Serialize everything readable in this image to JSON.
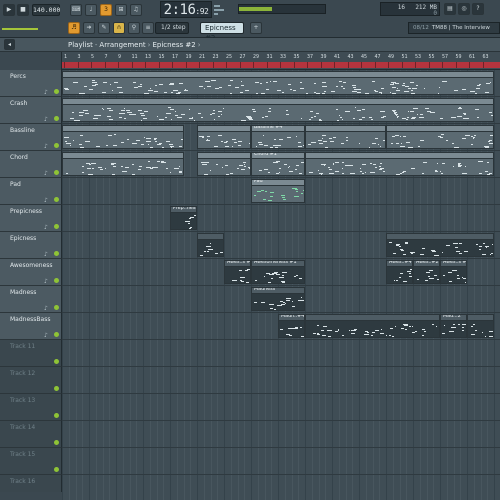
{
  "toolbar": {
    "tempo": "140.000",
    "time_main": "2:16",
    "time_sub": ":92",
    "snap": "1/2 step",
    "pattern": "Epicness #2",
    "cpu_value": "16",
    "mem_value": "212 MB",
    "mem_sub": "0",
    "news_date": "08/12",
    "news_text": "TM88 | The Interview",
    "buttons": [
      "play",
      "stop",
      "record",
      "pat-song",
      "song",
      "mic",
      "draw",
      "paint",
      "snap-magnet",
      "slice",
      "select",
      "zoom",
      "mute",
      "playback"
    ],
    "accent_color": "#e29a2f",
    "meter_color": "#8cb43a"
  },
  "breadcrumb": {
    "root": "Playlist",
    "section": "Arrangement",
    "pattern": "Epicness #2"
  },
  "ruler": {
    "ticks": [
      "1",
      "3",
      "5",
      "7",
      "9",
      "11",
      "13",
      "15",
      "17",
      "19",
      "21",
      "23",
      "25",
      "27",
      "29",
      "31",
      "33",
      "35",
      "37",
      "39",
      "41",
      "43",
      "45",
      "47",
      "49",
      "51",
      "53",
      "55",
      "57",
      "59",
      "61",
      "63"
    ]
  },
  "tracks": [
    {
      "name": "Percs",
      "empty": false
    },
    {
      "name": "Crash",
      "empty": false
    },
    {
      "name": "Bassline",
      "empty": false
    },
    {
      "name": "Chord",
      "empty": false
    },
    {
      "name": "Pad",
      "empty": false
    },
    {
      "name": "Prepicness",
      "empty": false
    },
    {
      "name": "Epicness",
      "empty": false
    },
    {
      "name": "Awesomeness",
      "empty": false
    },
    {
      "name": "Madness",
      "empty": false
    },
    {
      "name": "MadnessBass",
      "empty": false
    },
    {
      "name": "Track 11",
      "empty": true
    },
    {
      "name": "Track 12",
      "empty": true
    },
    {
      "name": "Track 13",
      "empty": true
    },
    {
      "name": "Track 14",
      "empty": true
    },
    {
      "name": "Track 15",
      "empty": true
    },
    {
      "name": "Track 16",
      "empty": true
    }
  ],
  "clips": [
    {
      "track": 0,
      "start": 1,
      "len": 64,
      "label": "",
      "style": "default"
    },
    {
      "track": 1,
      "start": 1,
      "len": 64,
      "label": "",
      "style": "default"
    },
    {
      "track": 2,
      "start": 1,
      "len": 18,
      "label": "",
      "style": "default"
    },
    {
      "track": 2,
      "start": 21,
      "len": 8,
      "label": "",
      "style": "default"
    },
    {
      "track": 2,
      "start": 29,
      "len": 8,
      "label": "Bassline #4",
      "style": "default"
    },
    {
      "track": 2,
      "start": 37,
      "len": 12,
      "label": "",
      "style": "default"
    },
    {
      "track": 2,
      "start": 49,
      "len": 16,
      "label": "",
      "style": "default"
    },
    {
      "track": 3,
      "start": 1,
      "len": 18,
      "label": "",
      "style": "default"
    },
    {
      "track": 3,
      "start": 21,
      "len": 8,
      "label": "",
      "style": "default"
    },
    {
      "track": 3,
      "start": 29,
      "len": 8,
      "label": "Chord #1",
      "style": "default"
    },
    {
      "track": 3,
      "start": 37,
      "len": 28,
      "label": "",
      "style": "default"
    },
    {
      "track": 4,
      "start": 29,
      "len": 8,
      "label": "Pad",
      "style": "green"
    },
    {
      "track": 5,
      "start": 17,
      "len": 4,
      "label": "Prep..ness",
      "style": "dark"
    },
    {
      "track": 6,
      "start": 21,
      "len": 4,
      "label": "",
      "style": "dark"
    },
    {
      "track": 6,
      "start": 49,
      "len": 16,
      "label": "",
      "style": "dark"
    },
    {
      "track": 7,
      "start": 25,
      "len": 4,
      "label": "Awes..s #1",
      "style": "dark"
    },
    {
      "track": 7,
      "start": 29,
      "len": 8,
      "label": "Awesomeness #1",
      "style": "dark"
    },
    {
      "track": 7,
      "start": 49,
      "len": 4,
      "label": "Awes..#4",
      "style": "dark"
    },
    {
      "track": 7,
      "start": 53,
      "len": 4,
      "label": "Awes..#2",
      "style": "dark"
    },
    {
      "track": 7,
      "start": 57,
      "len": 4,
      "label": "Awes..s #3",
      "style": "dark"
    },
    {
      "track": 8,
      "start": 29,
      "len": 8,
      "label": "Madness",
      "style": "dark"
    },
    {
      "track": 9,
      "start": 33,
      "len": 4,
      "label": "Madn..#4",
      "style": "dark"
    },
    {
      "track": 9,
      "start": 37,
      "len": 20,
      "label": "",
      "style": "dark"
    },
    {
      "track": 9,
      "start": 57,
      "len": 4,
      "label": "Mad...2",
      "style": "dark"
    },
    {
      "track": 9,
      "start": 61,
      "len": 4,
      "label": "",
      "style": "dark"
    }
  ]
}
